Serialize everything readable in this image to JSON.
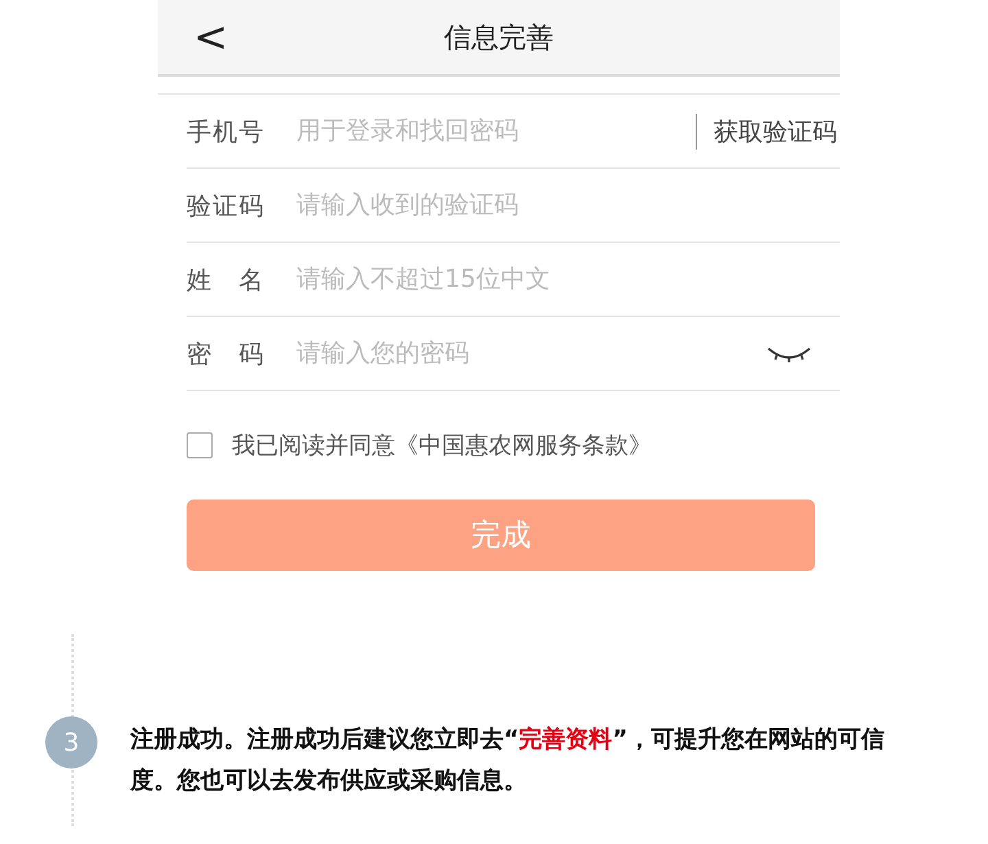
{
  "header": {
    "back": "<",
    "title": "信息完善"
  },
  "fields": [
    {
      "label": "手机号",
      "placeholder": "用于登录和找回密码",
      "action": "获取验证码"
    },
    {
      "label": "验证码",
      "placeholder": "请输入收到的验证码"
    },
    {
      "label": "姓名",
      "placeholder": "请输入不超过15位中文"
    },
    {
      "label": "密码",
      "placeholder": "请输入您的密码",
      "kind": "password"
    }
  ],
  "agreement": {
    "checked": false,
    "text": "我已阅读并同意《中国惠农网服务条款》"
  },
  "submit": "完成",
  "step": {
    "number": "3",
    "text_before": "注册成功。注册成功后建议您立即去“",
    "highlight": "完善资料",
    "text_after": "”，可提升您在网站的可信度。您也可以去发布供应或采购信息。"
  }
}
